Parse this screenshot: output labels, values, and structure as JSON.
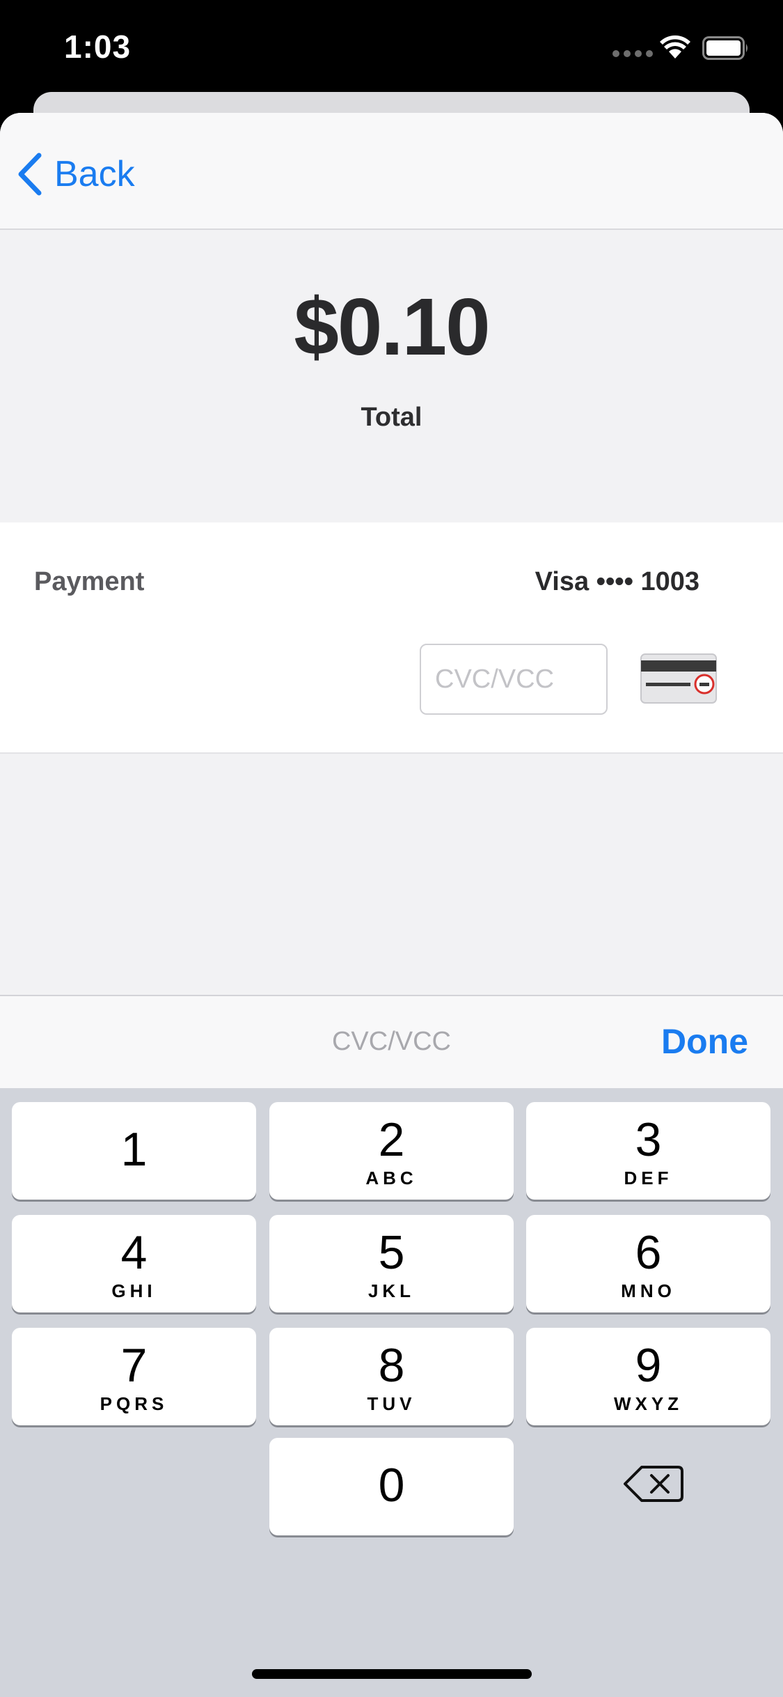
{
  "status_bar": {
    "time": "1:03"
  },
  "nav": {
    "back_label": "Back"
  },
  "summary": {
    "amount": "$0.10",
    "label": "Total"
  },
  "payment": {
    "label": "Payment",
    "card_summary": "Visa •••• 1003",
    "cvc_placeholder": "CVC/VCC",
    "cvc_value": ""
  },
  "accessory": {
    "title": "CVC/VCC",
    "done_label": "Done"
  },
  "keyboard": {
    "keys": [
      {
        "digit": "1",
        "letters": ""
      },
      {
        "digit": "2",
        "letters": "ABC"
      },
      {
        "digit": "3",
        "letters": "DEF"
      },
      {
        "digit": "4",
        "letters": "GHI"
      },
      {
        "digit": "5",
        "letters": "JKL"
      },
      {
        "digit": "6",
        "letters": "MNO"
      },
      {
        "digit": "7",
        "letters": "PQRS"
      },
      {
        "digit": "8",
        "letters": "TUV"
      },
      {
        "digit": "9",
        "letters": "WXYZ"
      },
      {
        "digit": "0",
        "letters": ""
      }
    ]
  },
  "colors": {
    "accent": "#1a7cf0",
    "keyboard_bg": "#d1d4db",
    "card_stripe": "#3a3a3a",
    "cvc_circle": "#d9302c"
  },
  "icons": {
    "back": "chevron-left-icon",
    "card": "card-back-cvc-icon",
    "delete": "delete-backspace-icon"
  }
}
